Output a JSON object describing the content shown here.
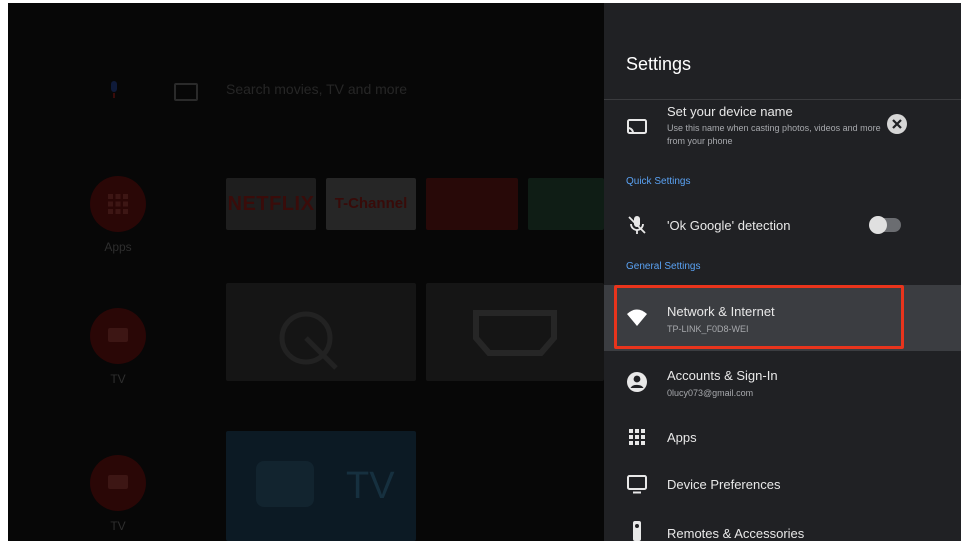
{
  "home": {
    "search_placeholder": "Search movies, TV and more",
    "sidebar": [
      {
        "label": "Apps",
        "icon": "apps-grid-icon"
      },
      {
        "label": "TV",
        "icon": "tv-input-icon"
      },
      {
        "label": "TV",
        "icon": "tv-input-icon"
      }
    ],
    "tiles": {
      "netflix": "NETFLIX",
      "channel": "T-Channel",
      "tv": "TV"
    }
  },
  "settings": {
    "title": "Settings",
    "device_name": {
      "title": "Set your device name",
      "subtitle": "Use this name when casting photos, videos and more from your phone",
      "icon": "cast-icon"
    },
    "quick_settings_header": "Quick Settings",
    "ok_google": {
      "label": "'Ok Google' detection",
      "icon": "mic-off-icon",
      "enabled": false
    },
    "general_settings_header": "General Settings",
    "items": [
      {
        "title": "Network & Internet",
        "subtitle": "TP-LINK_F0D8-WEI",
        "icon": "wifi-icon"
      },
      {
        "title": "Accounts & Sign-In",
        "subtitle": "0lucy073@gmail.com",
        "icon": "account-icon"
      },
      {
        "title": "Apps",
        "subtitle": "",
        "icon": "apps-icon"
      },
      {
        "title": "Device Preferences",
        "subtitle": "",
        "icon": "monitor-icon"
      },
      {
        "title": "Remotes & Accessories",
        "subtitle": "",
        "icon": "remote-icon"
      }
    ]
  },
  "colors": {
    "panel_bg": "#202124",
    "section_blue": "#5aa2f3",
    "highlight_box": "#e8341c"
  }
}
